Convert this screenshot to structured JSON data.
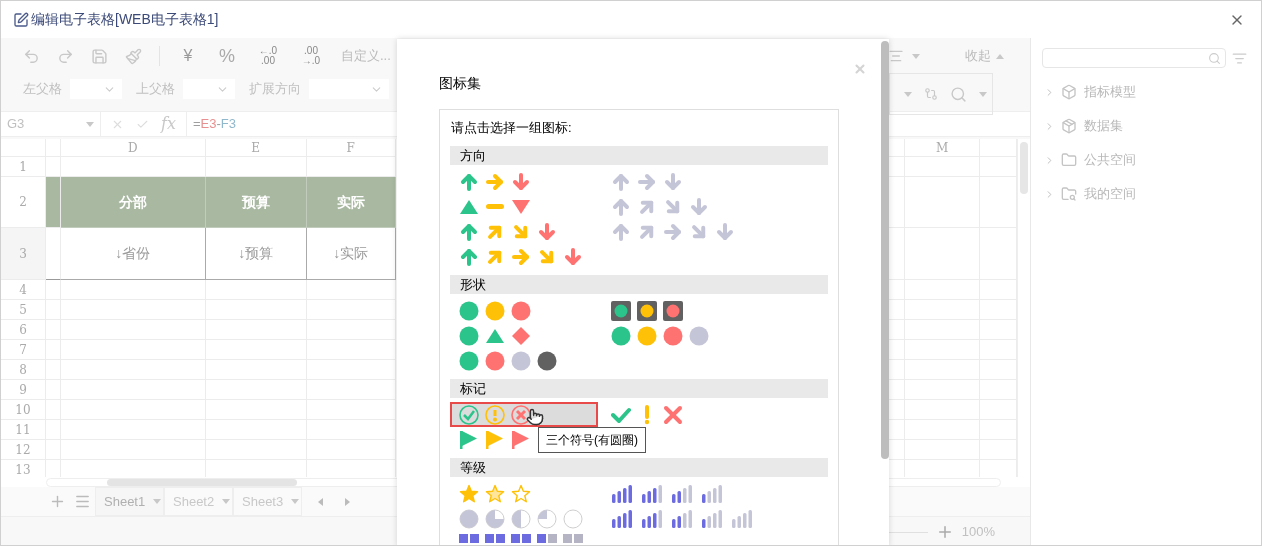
{
  "window": {
    "title": "编辑电子表格[WEB电子表格1]"
  },
  "toolbar": {
    "currency": "¥",
    "percent": "%",
    "decimal_buttons": [
      {
        "top": "←.0",
        "bottom": ".00"
      },
      {
        "top": ".00",
        "bottom": "→.0"
      }
    ],
    "number_format": "自定义...",
    "collapse": "收起",
    "parent_fields": [
      {
        "label": "左父格"
      },
      {
        "label": "上父格"
      },
      {
        "label": "扩展方向"
      }
    ]
  },
  "formula_bar": {
    "cell": "G3",
    "fx": "fx",
    "tokens": [
      {
        "text": "=",
        "color": "#9e9e9e"
      },
      {
        "text": "E3",
        "color": "#e89090"
      },
      {
        "text": "-",
        "color": "#9e9e9e"
      },
      {
        "text": "F3",
        "color": "#90b8cc"
      }
    ]
  },
  "sheet": {
    "columns": [
      "D",
      "E",
      "F",
      "M"
    ],
    "rows": [
      "1",
      "2",
      "3",
      "4",
      "5",
      "6",
      "7",
      "8",
      "9",
      "10",
      "11",
      "12",
      "13"
    ],
    "header_row": [
      "分部",
      "预算",
      "实际"
    ],
    "field_row": [
      "↓省份",
      "↓预算",
      "↓实际"
    ]
  },
  "sheet_tabs": [
    {
      "label": "Sheet1",
      "selected": true
    },
    {
      "label": "Sheet2",
      "selected": false
    },
    {
      "label": "Sheet3",
      "selected": false
    }
  ],
  "zoom": "100%",
  "sidebar": {
    "items": [
      {
        "label": "指标模型",
        "kind": "model",
        "expanded": false
      },
      {
        "label": "数据集",
        "kind": "dataset",
        "expanded": false
      },
      {
        "label": "公共空间",
        "kind": "folder",
        "expanded": false
      },
      {
        "label": "我的空间",
        "kind": "user-folder",
        "expanded": false
      }
    ]
  },
  "dialog": {
    "title": "图标集",
    "prompt": "请点击选择一组图标:",
    "sections": [
      {
        "title": "方向",
        "groups": [
          {
            "kind": "arrows3-color",
            "selected": false
          },
          {
            "kind": "arrows3-gray",
            "selected": false
          },
          {
            "kind": "triangles3",
            "selected": false
          },
          {
            "kind": "arrows4-gray",
            "selected": false
          },
          {
            "kind": "arrows4-color",
            "selected": false
          },
          {
            "kind": "arrows5-gray",
            "selected": false
          },
          {
            "kind": "arrows5-color",
            "selected": false
          }
        ]
      },
      {
        "title": "形状",
        "groups": [
          {
            "kind": "circles3",
            "selected": false
          },
          {
            "kind": "lights3",
            "selected": false
          },
          {
            "kind": "shapes3",
            "selected": false
          },
          {
            "kind": "circles4",
            "selected": false
          },
          {
            "kind": "circles4-dark",
            "selected": false
          }
        ]
      },
      {
        "title": "标记",
        "groups": [
          {
            "kind": "marks-circled",
            "selected": true,
            "tooltip": "三个符号(有圆圈)"
          },
          {
            "kind": "marks",
            "selected": false
          },
          {
            "kind": "flags",
            "selected": false
          }
        ]
      },
      {
        "title": "等级",
        "groups": [
          {
            "kind": "stars",
            "selected": false
          },
          {
            "kind": "signal4",
            "selected": false
          },
          {
            "kind": "pies",
            "selected": false
          },
          {
            "kind": "signal5",
            "selected": false
          },
          {
            "kind": "blocks",
            "selected": false
          }
        ]
      }
    ]
  }
}
